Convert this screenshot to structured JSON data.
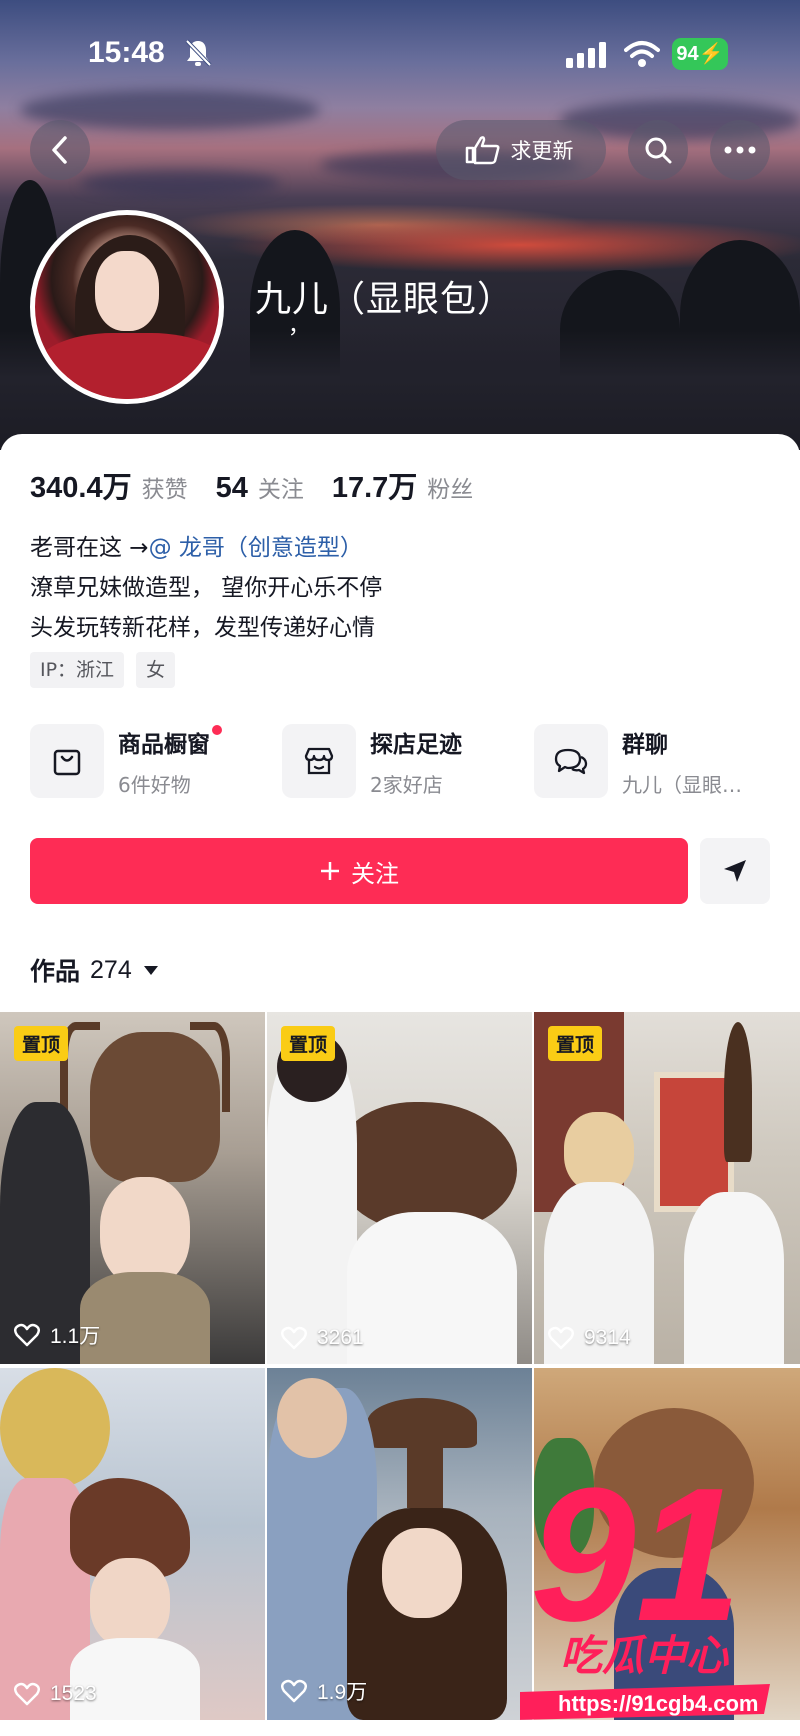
{
  "status_bar": {
    "time": "15:48",
    "battery": "94"
  },
  "header": {
    "update_label": "求更新"
  },
  "profile": {
    "nickname": "九儿（显眼包）",
    "nick_sub": "，"
  },
  "stats": [
    {
      "value": "340.4万",
      "label": "获赞"
    },
    {
      "value": "54",
      "label": "关注"
    },
    {
      "value": "17.7万",
      "label": "粉丝"
    }
  ],
  "bio": {
    "line1_prefix": "老哥在这 →",
    "line1_mention": "@ 龙哥（创意造型）",
    "line2": "潦草兄妹做造型， 望你开心乐不停",
    "line3": "头发玩转新花样，发型传递好心情"
  },
  "tags": [
    "IP：浙江",
    "女"
  ],
  "services": [
    {
      "title": "商品橱窗",
      "sub": "6件好物"
    },
    {
      "title": "探店足迹",
      "sub": "2家好店"
    },
    {
      "title": "群聊",
      "sub": "九儿（显眼…"
    }
  ],
  "follow_label": "关注",
  "works": {
    "label": "作品",
    "count": "274"
  },
  "pin_label": "置顶",
  "videos": [
    {
      "likes": "1.1万",
      "pinned": true
    },
    {
      "likes": "3261",
      "pinned": true
    },
    {
      "likes": "9314",
      "pinned": true
    },
    {
      "likes": "1523",
      "pinned": false
    },
    {
      "likes": "1.9万",
      "pinned": false
    },
    {
      "likes": "",
      "pinned": false
    }
  ],
  "watermark": {
    "number": "91",
    "name": "吃瓜中心",
    "url": "https://91cgb4.com"
  },
  "colors": {
    "accent": "#fe2c55",
    "pin": "#facc15",
    "mention": "#2d5fa8",
    "battery": "#34c759"
  }
}
